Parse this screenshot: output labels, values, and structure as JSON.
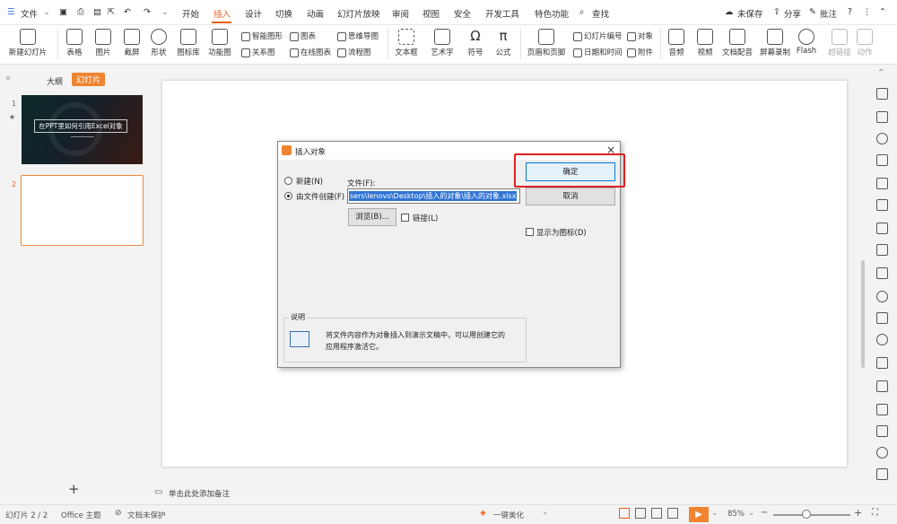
{
  "menubar": {
    "file": "文件",
    "tabs": [
      "开始",
      "插入",
      "设计",
      "切换",
      "动画",
      "幻灯片放映",
      "审阅",
      "视图",
      "安全",
      "开发工具",
      "特色功能"
    ],
    "search": "查找",
    "unsaved": "未保存",
    "share": "分享",
    "comment": "批注"
  },
  "ribbon": {
    "new_slide": "新建幻灯片",
    "table": "表格",
    "picture": "图片",
    "screenshot": "截屏",
    "shape": "形状",
    "icon_lib": "图标库",
    "func_chart": "功能图",
    "smart_art": "智能图形",
    "chart": "图表",
    "relation": "关系图",
    "online_chart": "在线图表",
    "mindmap": "思维导图",
    "flowchart": "流程图",
    "textbox": "文本框",
    "wordart": "艺术字",
    "symbol": "符号",
    "formula": "公式",
    "header_footer": "页眉和页脚",
    "slide_number": "幻灯片编号",
    "object": "对象",
    "datetime": "日期和时间",
    "attachment": "附件",
    "audio": "音频",
    "video": "视频",
    "narration": "文档配音",
    "screen_record": "屏幕录制",
    "flash": "Flash",
    "hyperlink": "超链接",
    "action": "动作"
  },
  "leftpane": {
    "outline_tab": "大纲",
    "slides_tab": "幻灯片",
    "slide1_num": "1",
    "slide1_title": "在PPT里如何引用Excel对象",
    "slide2_num": "2",
    "add": "+"
  },
  "notes": "单击此处添加备注",
  "dialog": {
    "title": "插入对象",
    "radio_new": "新建(N)",
    "radio_from_file": "由文件创建(F)",
    "file_label": "文件(F):",
    "file_path": "sers\\lenovo\\Desktop\\插入的对象\\插入的对象.xlsx",
    "browse": "浏览(B)...",
    "link": "链接(L)",
    "ok": "确定",
    "cancel": "取消",
    "show_icon": "显示为图标(D)",
    "desc_title": "说明",
    "desc_text1": "将文件内容作为对象插入到演示文稿中，可以用创建它的",
    "desc_text2": "应用程序激活它。"
  },
  "status": {
    "slide_count": "幻灯片 2 / 2",
    "theme": "Office 主题",
    "protect": "文档未保护",
    "beautify": "一键美化",
    "zoom": "85%"
  },
  "colors": {
    "accent": "#e8601c",
    "highlight": "#e02020"
  }
}
